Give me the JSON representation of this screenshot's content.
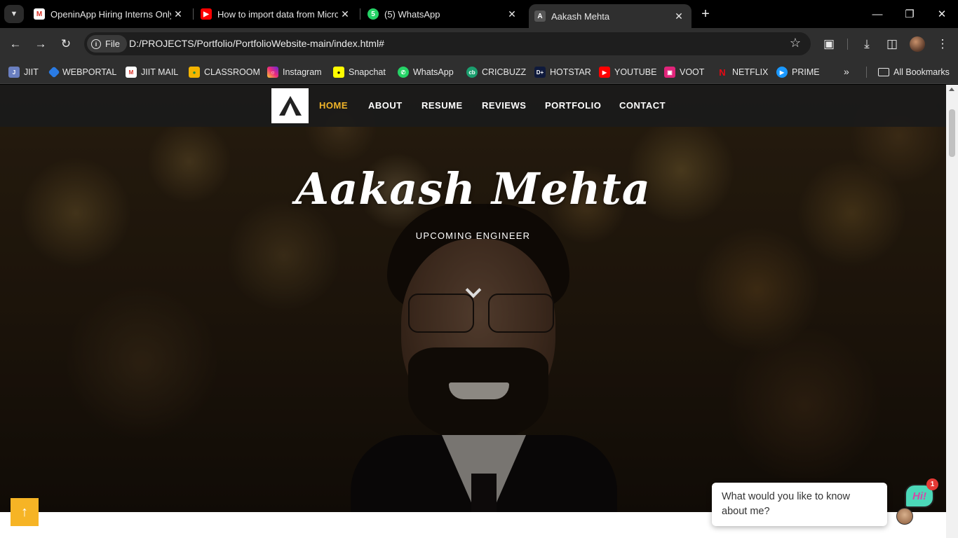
{
  "browser": {
    "tabs": [
      {
        "title": "OpeninApp Hiring Interns Only",
        "favicon": "gmail-icon"
      },
      {
        "title": "How to import data from Micro",
        "favicon": "youtube-icon"
      },
      {
        "title": "(5) WhatsApp",
        "favicon": "whatsapp-icon"
      },
      {
        "title": "Aakash Mehta",
        "favicon": "portfolio-logo-icon",
        "active": true
      }
    ],
    "address": {
      "scheme_label": "File",
      "url": "D:/PROJECTS/Portfolio/PortfolioWebsite-main/index.html#"
    },
    "bookmarks": [
      {
        "label": "JIIT",
        "icon": "jiit-icon"
      },
      {
        "label": "WEBPORTAL",
        "icon": "webportal-icon"
      },
      {
        "label": "JIIT MAIL",
        "icon": "gmail-icon"
      },
      {
        "label": "CLASSROOM",
        "icon": "classroom-icon"
      },
      {
        "label": "Instagram",
        "icon": "instagram-icon"
      },
      {
        "label": "Snapchat",
        "icon": "snapchat-icon"
      },
      {
        "label": "WhatsApp",
        "icon": "whatsapp-icon"
      },
      {
        "label": "CRICBUZZ",
        "icon": "cricbuzz-icon"
      },
      {
        "label": "HOTSTAR",
        "icon": "hotstar-icon"
      },
      {
        "label": "YOUTUBE",
        "icon": "youtube-icon"
      },
      {
        "label": "VOOT",
        "icon": "voot-icon"
      },
      {
        "label": "NETFLIX",
        "icon": "netflix-icon"
      },
      {
        "label": "PRIME",
        "icon": "prime-icon"
      }
    ],
    "all_bookmarks_label": "All Bookmarks"
  },
  "site": {
    "nav": [
      {
        "label": "HOME",
        "active": true
      },
      {
        "label": "ABOUT"
      },
      {
        "label": "RESUME"
      },
      {
        "label": "REVIEWS"
      },
      {
        "label": "PORTFOLIO"
      },
      {
        "label": "CONTACT"
      }
    ],
    "hero": {
      "name": "Aakash Mehta",
      "subtitle": "UPCOMING ENGINEER"
    },
    "chat": {
      "prompt": "What would you like to know about me?",
      "launcher_text": "Hi!",
      "badge_count": "1"
    }
  },
  "colors": {
    "accent": "#f0b429",
    "back_to_top": "#f6b425",
    "nav_bg": "#1a1a1a"
  }
}
